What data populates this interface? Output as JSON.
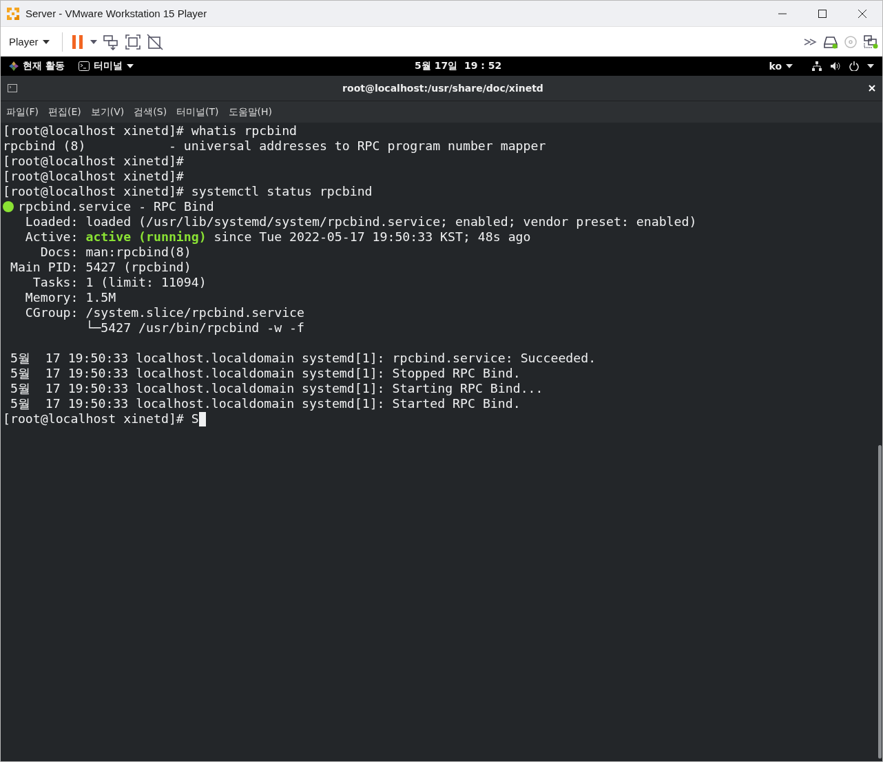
{
  "window": {
    "title": "Server - VMware Workstation 15 Player"
  },
  "toolbar": {
    "player_menu": "Player"
  },
  "top_bar": {
    "activities": "현재 활동",
    "app_menu": "터미널",
    "clock": "5월 17일  19 : 52",
    "language": "ko"
  },
  "terminal": {
    "title": "root@localhost:/usr/share/doc/xinetd",
    "menu": [
      "파일(F)",
      "편집(E)",
      "보기(V)",
      "검색(S)",
      "터미널(T)",
      "도움말(H)"
    ],
    "lines": [
      {
        "kind": "plain",
        "text": "[root@localhost xinetd]# whatis rpcbind"
      },
      {
        "kind": "plain",
        "text": "rpcbind (8)           - universal addresses to RPC program number mapper"
      },
      {
        "kind": "plain",
        "text": "[root@localhost xinetd]#"
      },
      {
        "kind": "plain",
        "text": "[root@localhost xinetd]#"
      },
      {
        "kind": "plain",
        "text": "[root@localhost xinetd]# systemctl status rpcbind"
      },
      {
        "kind": "status",
        "text": "rpcbind.service - RPC Bind",
        "color": "#8ae234"
      },
      {
        "kind": "plain",
        "text": "   Loaded: loaded (/usr/lib/systemd/system/rpcbind.service; enabled; vendor preset: enabled)"
      },
      {
        "kind": "highlight",
        "prefix": "   Active: ",
        "highlight": "active (running)",
        "suffix": " since Tue 2022-05-17 19:50:33 KST; 48s ago"
      },
      {
        "kind": "plain",
        "text": "     Docs: man:rpcbind(8)"
      },
      {
        "kind": "plain",
        "text": " Main PID: 5427 (rpcbind)"
      },
      {
        "kind": "plain",
        "text": "    Tasks: 1 (limit: 11094)"
      },
      {
        "kind": "plain",
        "text": "   Memory: 1.5M"
      },
      {
        "kind": "plain",
        "text": "   CGroup: /system.slice/rpcbind.service"
      },
      {
        "kind": "plain",
        "text": "           └─5427 /usr/bin/rpcbind -w -f"
      },
      {
        "kind": "blank"
      },
      {
        "kind": "plain",
        "text": " 5월  17 19:50:33 localhost.localdomain systemd[1]: rpcbind.service: Succeeded."
      },
      {
        "kind": "plain",
        "text": " 5월  17 19:50:33 localhost.localdomain systemd[1]: Stopped RPC Bind."
      },
      {
        "kind": "plain",
        "text": " 5월  17 19:50:33 localhost.localdomain systemd[1]: Starting RPC Bind..."
      },
      {
        "kind": "plain",
        "text": " 5월  17 19:50:33 localhost.localdomain systemd[1]: Started RPC Bind."
      },
      {
        "kind": "prompt",
        "text": "[root@localhost xinetd]# S"
      }
    ]
  }
}
